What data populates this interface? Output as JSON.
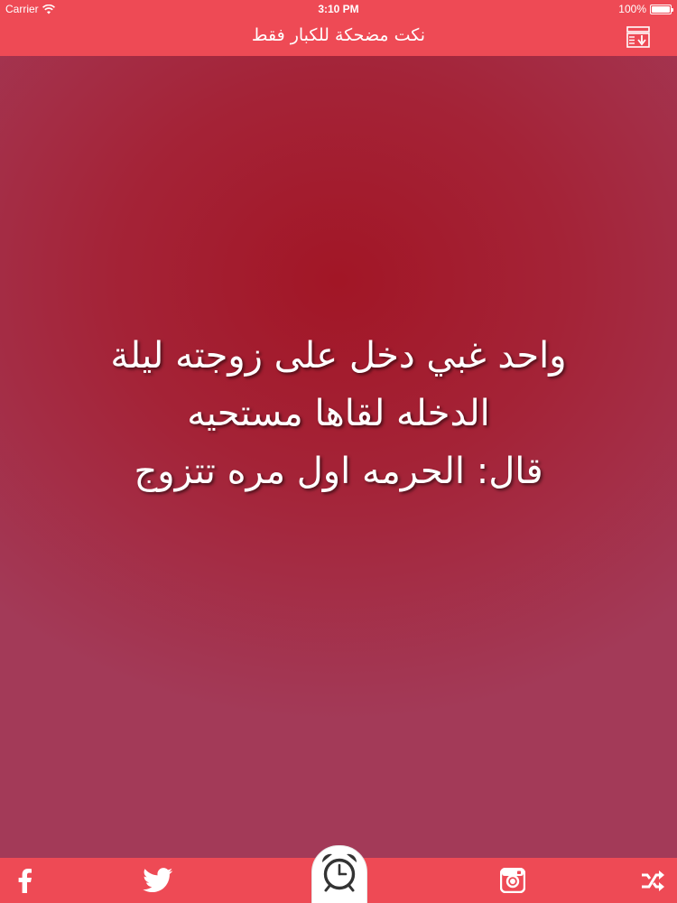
{
  "status_bar": {
    "carrier": "Carrier",
    "time": "3:10 PM",
    "battery": "100%",
    "battery_level": 1.0
  },
  "nav_bar": {
    "title": "نكت مضحكة للكبار فقط",
    "menu_icon": "download-list-icon"
  },
  "joke": {
    "lines": [
      "واحد غبي دخل على زوجته ليلة",
      "الدخله لقاها مستحيه",
      "قال: الحرمه اول مره تتزوج"
    ]
  },
  "toolbar": {
    "facebook_icon": "facebook-icon",
    "twitter_icon": "twitter-icon",
    "alarm_icon": "alarm-clock-icon",
    "instagram_icon": "instagram-icon",
    "share_icon": "shuffle-arrows-icon"
  },
  "colors": {
    "bar": "#ee4a55",
    "background": "#a42337",
    "text": "#ffffff"
  }
}
